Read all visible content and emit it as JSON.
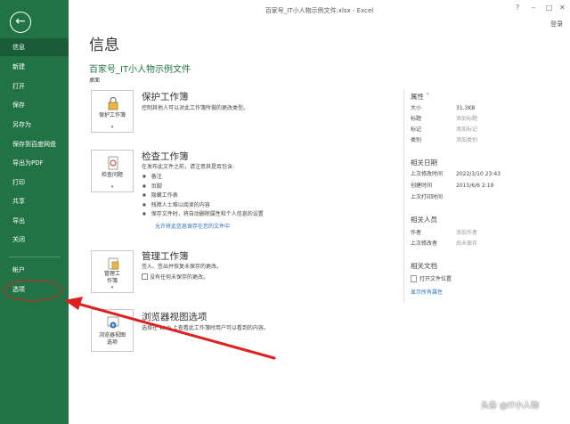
{
  "window": {
    "title": "百家号_IT小人物示例文件.xlsx - Excel",
    "help": "?",
    "minimize": "–",
    "restore": "□",
    "close": "✕",
    "signin": "登录"
  },
  "sidebar": {
    "back": "←",
    "items": [
      "信息",
      "新建",
      "打开",
      "保存",
      "另存为",
      "保存到百度网盘",
      "导出为PDF",
      "打印",
      "共享",
      "导出",
      "关闭"
    ],
    "bottom_items": [
      "帐户",
      "选项"
    ]
  },
  "main": {
    "title": "信息",
    "file_name": "百家号_IT小人物示例文件",
    "file_location": "桌面",
    "sections": [
      {
        "button": "保护工作簿",
        "heading": "保护工作簿",
        "description": "控制其他人可以对此工作簿所做的更改类型。"
      },
      {
        "button": "检查问题",
        "heading": "检查工作簿",
        "description": "在发布此文件之前，请注意其是否包含:",
        "bullets": [
          "备注",
          "页脚",
          "隐藏工作表",
          "残障人士难以阅读的内容",
          "保存文件时，将自动删除属性和个人信息的设置"
        ],
        "link": "允许将此信息保存在您的文件中"
      },
      {
        "button_lines": [
          "管理工",
          "作簿"
        ],
        "heading": "管理工作簿",
        "description": "签入、签出并恢复未保存的更改。",
        "checkbox": "没有任何未保存的更改。"
      },
      {
        "button_lines": [
          "浏览器视图",
          "选项"
        ],
        "heading": "浏览器视图选项",
        "description": "选择在 Web 上查看此工作簿时用户可以看到的内容。"
      }
    ]
  },
  "properties": {
    "title": "属性 ˇ",
    "rows": [
      {
        "key": "大小",
        "value": "31.3KB"
      },
      {
        "key": "标题",
        "value": "添加标题"
      },
      {
        "key": "标记",
        "value": "添加标记"
      },
      {
        "key": "类别",
        "value": "添加类别"
      }
    ],
    "dates_title": "相关日期",
    "dates": [
      {
        "key": "上次修改时间",
        "value": "2022/3/10 23:43"
      },
      {
        "key": "创建时间",
        "value": "2015/6/6 2:19"
      },
      {
        "key": "上次打印时间",
        "value": ""
      }
    ],
    "people_title": "相关人员",
    "people": [
      {
        "key": "作者",
        "value": "添加作者"
      },
      {
        "key": "上次修改者",
        "value": "尚未保存"
      }
    ],
    "docs_title": "相关文档",
    "open_folder": "打开文件位置",
    "show_all": "显示所有属性"
  },
  "watermark": "头条 @IT小人物",
  "colors": {
    "accent": "#217346",
    "annotation": "#e02020",
    "link": "#2a6ebb"
  }
}
